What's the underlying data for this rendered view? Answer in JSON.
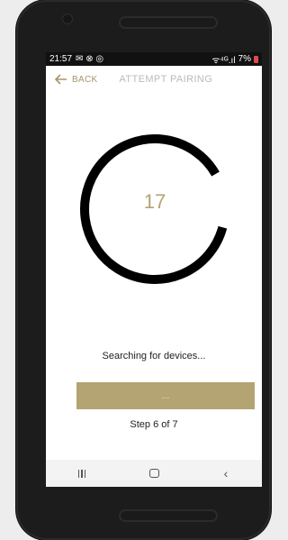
{
  "status_bar": {
    "time": "21:57",
    "notification_icons": "✉ ⊗ ◎",
    "battery_percent": "7%",
    "signal": "ᯤ⁴ᴳ.ıl"
  },
  "app_bar": {
    "back_label": "BACK",
    "title": "ATTEMPT PAIRING"
  },
  "pairing": {
    "countdown": "17",
    "status_text": "Searching for devices...",
    "button_label": "...",
    "step_text": "Step 6 of 7"
  },
  "colors": {
    "accent": "#b4a373",
    "ring": "#000000"
  },
  "nav_bar": {
    "icons": [
      "recent-apps-icon",
      "home-icon",
      "back-icon"
    ]
  }
}
